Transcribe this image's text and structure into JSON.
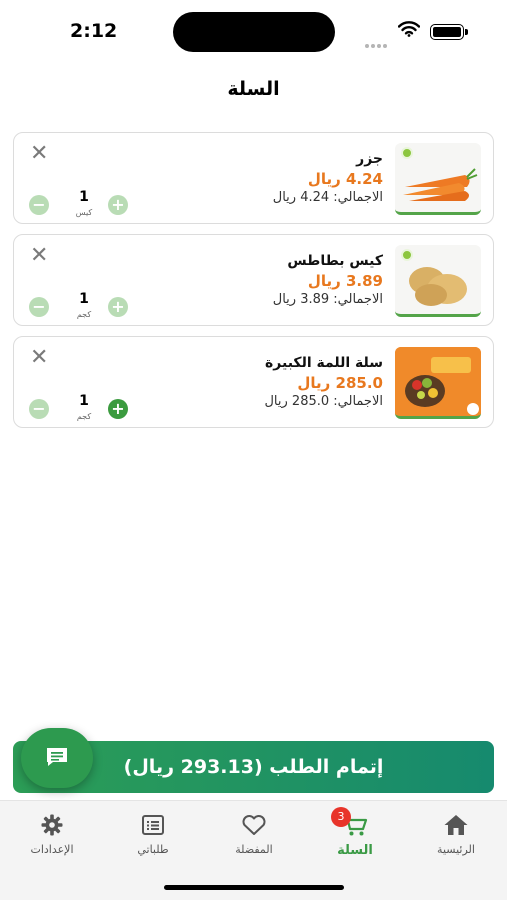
{
  "status": {
    "time": "2:12"
  },
  "header": {
    "title": "السلة"
  },
  "cart": {
    "items": [
      {
        "name": "جزر",
        "price": "4.24 ريال",
        "total": "الاجمالي: 4.24 ريال",
        "quantity": "1",
        "unit": "كيس",
        "image": "carrots"
      },
      {
        "name": "كيس بطاطس",
        "price": "3.89 ريال",
        "total": "الاجمالي: 3.89 ريال",
        "quantity": "1",
        "unit": "كجم",
        "image": "potatoes"
      },
      {
        "name": "سلة اللمة الكبيرة",
        "price": "285.0 ريال",
        "total": "الاجمالي: 285.0 ريال",
        "quantity": "1",
        "unit": "كجم",
        "image": "produce-basket"
      }
    ],
    "checkout_label": "إتمام الطلب (293.13 ريال)"
  },
  "tabbar": {
    "items": [
      {
        "label": "الإعدادات",
        "icon": "gear-icon"
      },
      {
        "label": "طلباتي",
        "icon": "list-icon"
      },
      {
        "label": "المفضلة",
        "icon": "heart-icon"
      },
      {
        "label": "السلة",
        "icon": "cart-icon",
        "badge": "3",
        "active": true
      },
      {
        "label": "الرئيسية",
        "icon": "home-icon"
      }
    ]
  },
  "colors": {
    "accent": "#3a9a45",
    "price": "#e8781e",
    "badge": "#e8342a"
  }
}
